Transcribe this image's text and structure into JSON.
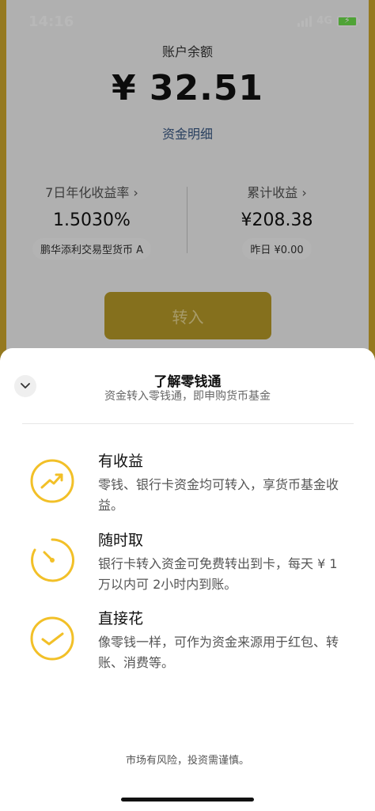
{
  "status_bar": {
    "time": "14:16",
    "network": "4G"
  },
  "account": {
    "balance_label": "账户余额",
    "balance_amount": "¥ 32.51",
    "detail_link": "资金明细"
  },
  "stats": {
    "yield_title": "7日年化收益率 ›",
    "yield_value": "1.5030%",
    "fund_name": "鹏华添利交易型货币 A",
    "total_title": "累计收益 ›",
    "total_value": "¥208.38",
    "yesterday": "昨日 ¥0.00"
  },
  "transfer_button": "转入",
  "sheet": {
    "title": "了解零钱通",
    "subtitle": "资金转入零钱通，即申购货币基金",
    "features": [
      {
        "title": "有收益",
        "desc": "零钱、银行卡资金均可转入，享货币基金收益。",
        "icon": "trend-up-icon"
      },
      {
        "title": "随时取",
        "desc": "银行卡转入资金可免费转出到卡，每天 ¥ 1万以内可 2小时内到账。",
        "icon": "gauge-icon"
      },
      {
        "title": "直接花",
        "desc": "像零钱一样，可作为资金来源用于红包、转账、消费等。",
        "icon": "checkmark-icon"
      }
    ],
    "risk_note": "市场有风险，投资需谨慎。"
  },
  "colors": {
    "accent": "#f2c028",
    "link": "#3b5a86"
  }
}
